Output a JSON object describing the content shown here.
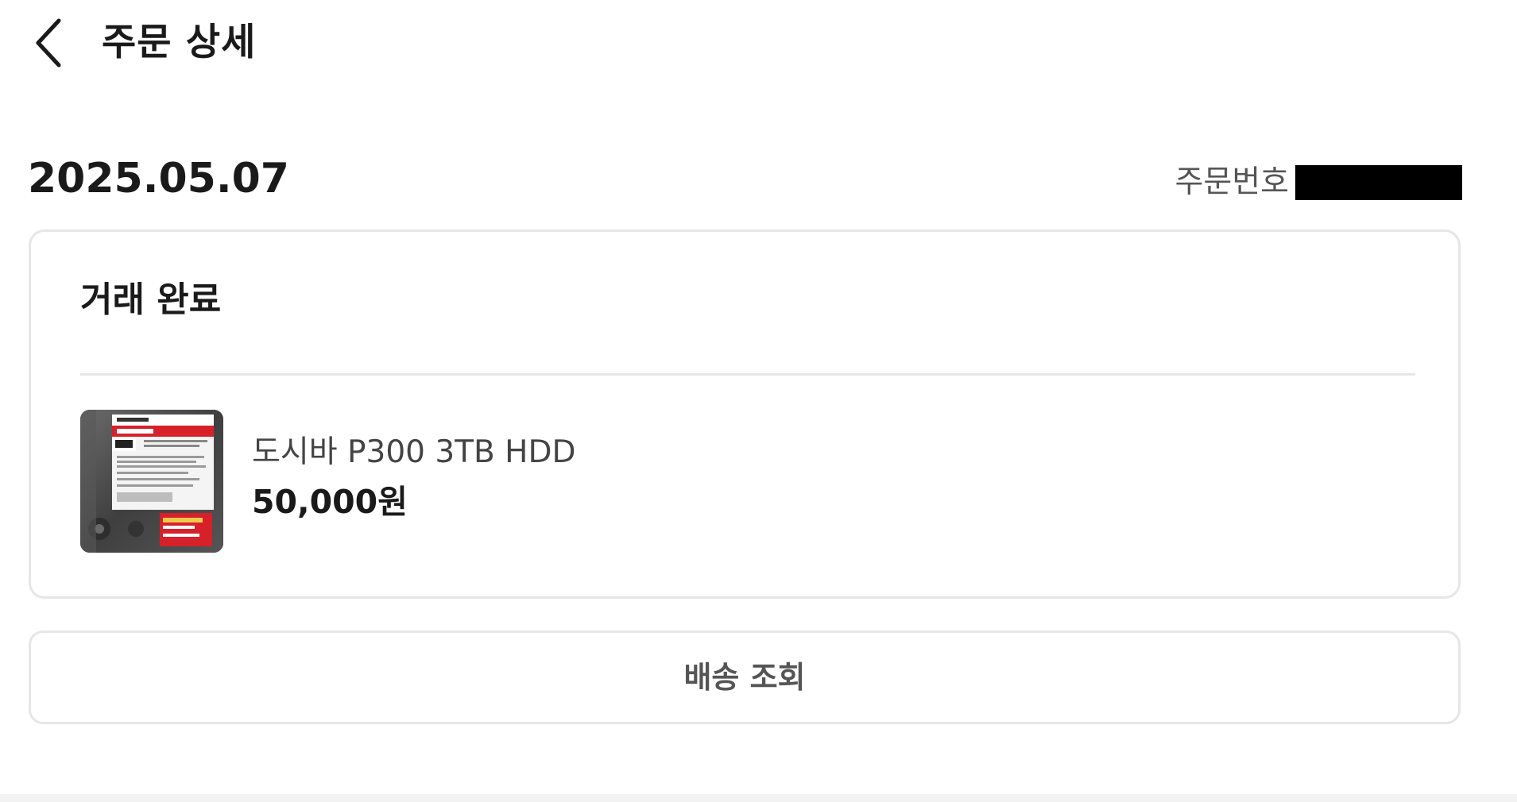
{
  "header": {
    "title": "주문 상세",
    "back_icon": "chevron-left-icon"
  },
  "order": {
    "date": "2025.05.07",
    "number_label": "주문번호",
    "number_value": "",
    "number_redacted": true
  },
  "status_card": {
    "status": "거래 완료",
    "product": {
      "name": "도시바 P300 3TB HDD",
      "price": "50,000원",
      "thumbnail_icon": "hdd-product-photo"
    }
  },
  "actions": {
    "track_delivery_label": "배송 조회"
  },
  "colors": {
    "background": "#ffffff",
    "border": "#e6e6e6",
    "text_primary": "#1a1a1a",
    "text_secondary": "#555555",
    "redaction": "#000000",
    "label_red": "#d6202a"
  }
}
